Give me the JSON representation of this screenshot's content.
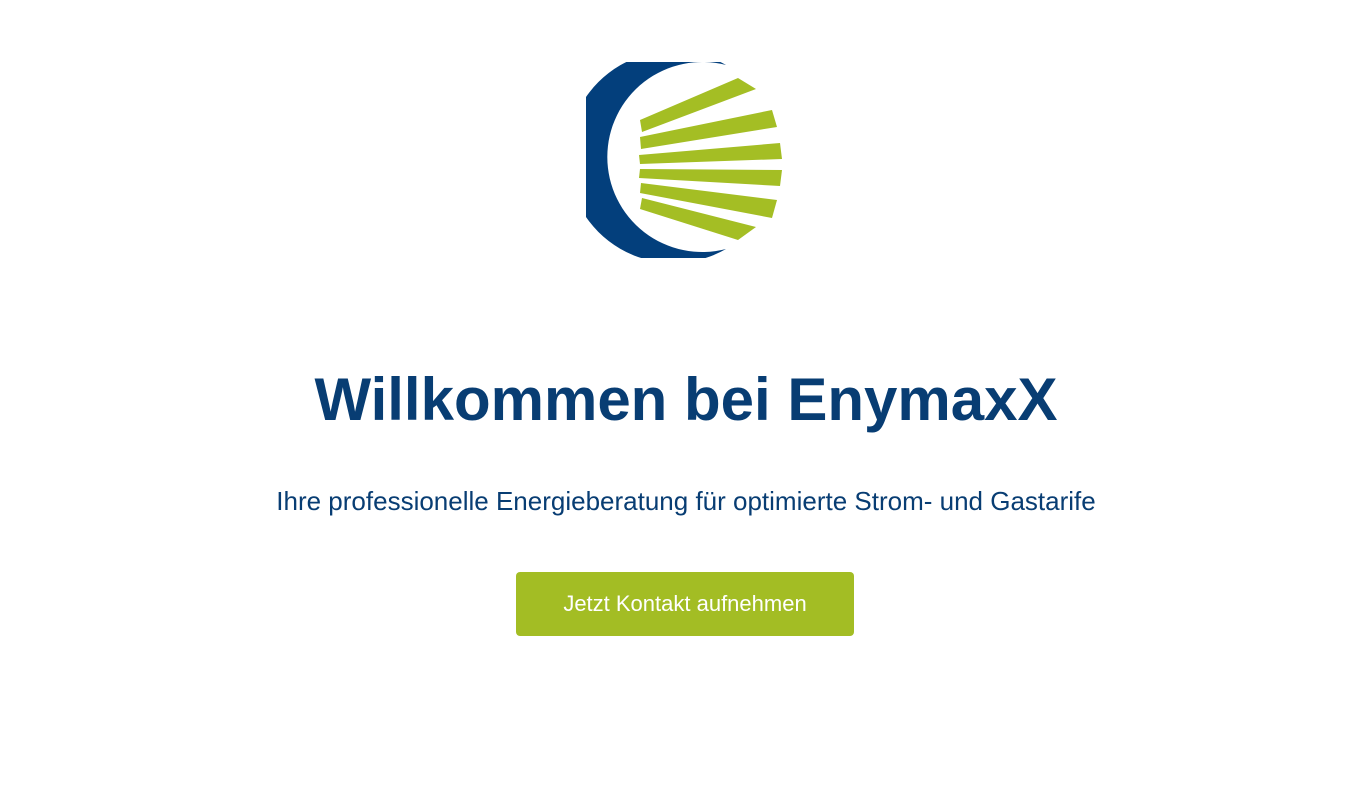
{
  "logo": {
    "icon": "enymaxx-logo-icon",
    "colors": {
      "crescent": "#033f7c",
      "rays": "#a4be24"
    }
  },
  "hero": {
    "title": "Willkommen bei EnymaxX",
    "subtitle": "Ihre professionelle Energieberatung für optimierte Strom- und Gastarife",
    "cta_label": "Jetzt Kontakt aufnehmen"
  },
  "colors": {
    "heading": "#083d73",
    "button_bg": "#a3bd24",
    "button_text": "#ffffff",
    "background": "#ffffff"
  }
}
